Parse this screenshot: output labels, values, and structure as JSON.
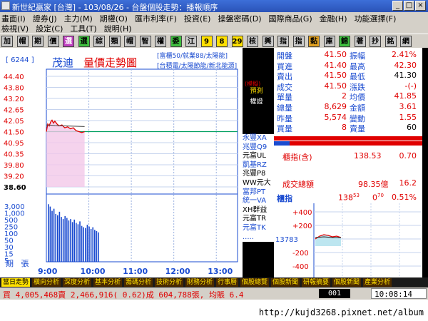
{
  "window": {
    "title": "新世紀贏家 [台灣] - 103/08/26 - 台盤個股走勢：播報順序",
    "buttons": [
      "_",
      "□",
      "×"
    ]
  },
  "menu": {
    "row1": [
      "畫面(I)",
      "證券(J)",
      "主力(M)",
      "期權(O)",
      "匯市利率(F)",
      "投資(E)",
      "操盤密碼(D)",
      "國際商品(G)",
      "金融(H)",
      "功能選擇(F)"
    ],
    "row1_dim": [
      "功能選擇(F)"
    ],
    "row2": [
      "檢視(V)",
      "設定(C)",
      "工具(T)",
      "說明(H)"
    ]
  },
  "toolbar": {
    "buttons": [
      "加",
      "帽",
      "期",
      "價",
      "選",
      "選",
      "綜",
      "類",
      "帽",
      "智",
      "權",
      "委",
      "江",
      "9",
      "8",
      "29",
      "核",
      "興",
      "指",
      "指",
      "黏",
      "庫",
      "錦",
      "著",
      "抄",
      "銘",
      "網"
    ]
  },
  "chart_header": {
    "code": "[ 6244 ]",
    "name": "茂迪",
    "title": "量價走勢圖",
    "tags1": "[富櫃50/就業88/太陽能]",
    "tags2": "[台積電/太陽節能/新北能源]"
  },
  "chart_data": {
    "type": "line",
    "price_ticks": [
      "44.40",
      "43.80",
      "43.20",
      "42.65",
      "42.05",
      "41.50",
      "40.95",
      "40.35",
      "39.80",
      "39.20",
      "38.60"
    ],
    "flat_tick": "38.60",
    "volume_ticks": [
      "3,000",
      "1,000",
      "500",
      "250",
      "100",
      "50",
      "30",
      "15",
      "5"
    ],
    "volume_label": "張",
    "period_label": "期",
    "x_ticks": [
      "9:00",
      "10:00",
      "11:00",
      "12:00",
      "13:00"
    ],
    "ref_price": 41.5,
    "ylim": [
      38.6,
      44.4
    ],
    "price_series": [
      {
        "t": 0,
        "p": 41.5
      },
      {
        "t": 2,
        "p": 41.9
      },
      {
        "t": 4,
        "p": 41.8
      },
      {
        "t": 6,
        "p": 42.0
      },
      {
        "t": 8,
        "p": 42.1
      },
      {
        "t": 10,
        "p": 41.95
      },
      {
        "t": 12,
        "p": 42.05
      },
      {
        "t": 15,
        "p": 41.9
      },
      {
        "t": 18,
        "p": 41.8
      },
      {
        "t": 22,
        "p": 41.85
      },
      {
        "t": 26,
        "p": 41.7
      },
      {
        "t": 30,
        "p": 41.75
      },
      {
        "t": 34,
        "p": 41.65
      },
      {
        "t": 38,
        "p": 41.7
      },
      {
        "t": 42,
        "p": 41.55
      },
      {
        "t": 46,
        "p": 41.5
      },
      {
        "t": 50,
        "p": 41.45
      },
      {
        "t": 54,
        "p": 41.5
      }
    ],
    "volume_series": [
      2200,
      1600,
      900,
      1200,
      600,
      500,
      800,
      400,
      300,
      450,
      350,
      250,
      300,
      200,
      280,
      180,
      150,
      220,
      120,
      100,
      90,
      140,
      110,
      80,
      100,
      70,
      60,
      50
    ]
  },
  "broker": {
    "warn": "(模擬)",
    "head": "預測",
    "sub": "權證",
    "items": [
      "永豐XA",
      "兆豐Q9",
      "元富UL",
      "凱基RZ",
      "兆豐P8",
      "WW元大",
      "富邦PT",
      "統一VA",
      "XH群益",
      "元富TR",
      "元富TK",
      "....."
    ]
  },
  "quote": {
    "rows": [
      {
        "k1": "開盤",
        "v1": "41.50",
        "k2": "振幅",
        "v2": "2.41%",
        "v2c": "red"
      },
      {
        "k1": "買進",
        "v1": "41.40",
        "k2": "最高",
        "v2": "42.30",
        "v2c": "red"
      },
      {
        "k1": "賣出",
        "v1": "41.50",
        "k2": "最低",
        "v2": "41.30",
        "v2c": "blk"
      },
      {
        "k1": "成交",
        "v1": "41.50",
        "k2": "漲跌",
        "v2": "-(-)",
        "v2c": "red"
      },
      {
        "k1": "單量",
        "v1": "2",
        "k2": "均價",
        "v2": "41.85",
        "v2c": "red"
      },
      {
        "k1": "總量",
        "v1": "8,629",
        "k2": "金額",
        "v2": "3.61",
        "v2c": "red"
      },
      {
        "k1": "昨量",
        "v1": "5,574",
        "k2": "變動",
        "v2": "1.55",
        "v2c": "red"
      },
      {
        "k1": "買量",
        "v1": "8",
        "k2": "賣量",
        "v2": "60",
        "v2c": "blk"
      }
    ]
  },
  "index": {
    "label": "櫃指(含)",
    "value": "138.53",
    "change": "0.70",
    "total_label": "成交總額",
    "total_value": "98.35億",
    "total_change": "16.2"
  },
  "mini_chart": {
    "label": "櫃指",
    "value": "138",
    "value_sup": "53",
    "change": "0",
    "change_sup": "70",
    "pct": "0.51%",
    "ticks": [
      "+400",
      "+200",
      "13783",
      "-200",
      "-400"
    ]
  },
  "tabs": [
    "當日走勢",
    "橫向分析",
    "深度分析",
    "基本分析",
    "籌碼分析",
    "技術分析",
    "財務分析",
    "行事曆",
    "個股總覽",
    "個股新聞",
    "研報摘要",
    "個股新聞",
    "產業分析"
  ],
  "status": {
    "text": "買 4,005,468賣 2,466,916( 0.62)成 604,788張, 均賬 6.4",
    "code": "001",
    "time": "10:08:14"
  },
  "footer": {
    "url": "http://kujd3268.pixnet.net/album"
  },
  "colors": {
    "up": "#e00000",
    "down": "#00a000",
    "accent": "#1a4bd0",
    "volume": "#1a4bd0"
  }
}
